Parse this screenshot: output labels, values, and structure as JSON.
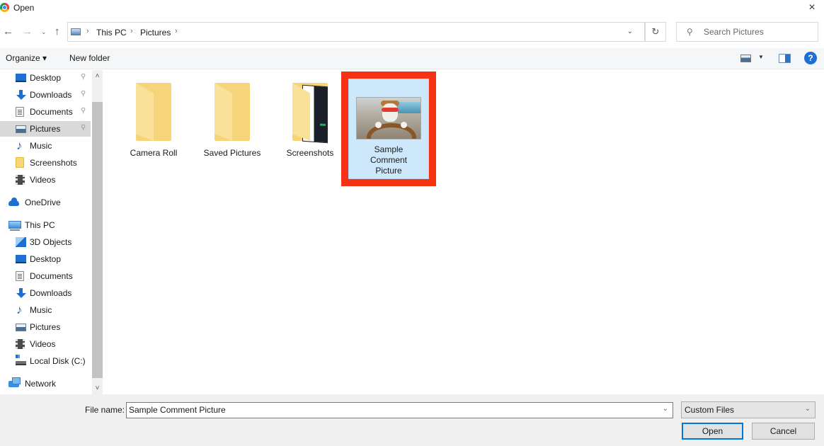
{
  "window": {
    "title": "Open",
    "close_icon": "×"
  },
  "navigation": {
    "back_icon": "←",
    "forward_icon": "→",
    "recent_icon": "⌄",
    "up_icon": "↑",
    "breadcrumb": [
      "This PC",
      "Pictures"
    ],
    "breadcrumb_separator": "›",
    "dropdown_icon": "⌄",
    "refresh_icon": "↻",
    "search_placeholder": "Search Pictures",
    "search_icon": "⚲"
  },
  "toolbar": {
    "organize_label": "Organize ▾",
    "new_folder_label": "New folder",
    "view_caret": "▼",
    "help_label": "?"
  },
  "sidebar": {
    "quick_access": [
      {
        "label": "Desktop",
        "icon": "desktop-icon",
        "pinned": true
      },
      {
        "label": "Downloads",
        "icon": "downloads-icon",
        "pinned": true
      },
      {
        "label": "Documents",
        "icon": "documents-icon",
        "pinned": true
      },
      {
        "label": "Pictures",
        "icon": "pictures-icon",
        "pinned": true,
        "selected": true
      },
      {
        "label": "Music",
        "icon": "music-icon",
        "pinned": false
      },
      {
        "label": "Screenshots",
        "icon": "folder-icon",
        "pinned": false
      },
      {
        "label": "Videos",
        "icon": "videos-icon",
        "pinned": false
      }
    ],
    "onedrive": {
      "label": "OneDrive",
      "icon": "onedrive-icon"
    },
    "this_pc": {
      "label": "This PC",
      "icon": "computer-icon"
    },
    "this_pc_items": [
      {
        "label": "3D Objects",
        "icon": "3d-objects-icon"
      },
      {
        "label": "Desktop",
        "icon": "desktop-icon"
      },
      {
        "label": "Documents",
        "icon": "documents-icon"
      },
      {
        "label": "Downloads",
        "icon": "downloads-icon"
      },
      {
        "label": "Music",
        "icon": "music-icon"
      },
      {
        "label": "Pictures",
        "icon": "pictures-icon"
      },
      {
        "label": "Videos",
        "icon": "videos-icon"
      },
      {
        "label": "Local Disk (C:)",
        "icon": "local-disk-icon"
      }
    ],
    "network": {
      "label": "Network",
      "icon": "network-icon"
    },
    "pin_icon": "📌",
    "scroll_up": "˄",
    "scroll_down": "˅"
  },
  "files": [
    {
      "name": "Camera Roll",
      "type": "folder"
    },
    {
      "name": "Saved Pictures",
      "type": "folder"
    },
    {
      "name": "Screenshots",
      "type": "folder"
    },
    {
      "name": "Sample Comment Picture",
      "name_lines": [
        "Sample",
        "Comment",
        "Picture"
      ],
      "type": "image",
      "selected": true,
      "highlight_color": "#f53314"
    }
  ],
  "bottom": {
    "file_name_label": "File name:",
    "file_name_value": "Sample Comment Picture",
    "file_type_value": "Custom Files",
    "caret": "⌄",
    "open_label": "Open",
    "cancel_label": "Cancel"
  }
}
